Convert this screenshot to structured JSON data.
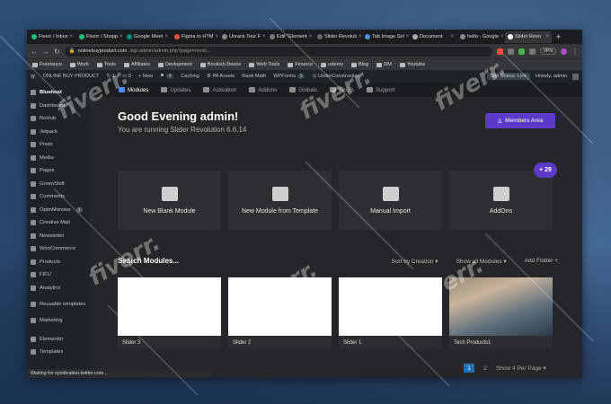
{
  "tabs": [
    {
      "label": "Fiverr / Inbox",
      "color": "#1dbf73"
    },
    {
      "label": "Fiverr / Shopp",
      "color": "#1dbf73"
    },
    {
      "label": "Google Meet",
      "color": "#00897b"
    },
    {
      "label": "Figma to HTM",
      "color": "#e94f3d"
    },
    {
      "label": "Unrack Tour F",
      "color": "#888888"
    },
    {
      "label": "Edit \"Element",
      "color": "#777777"
    },
    {
      "label": "Slider Revoluti",
      "color": "#666666"
    },
    {
      "label": "Tab Image Sel",
      "color": "#4a90d9"
    },
    {
      "label": "Document",
      "color": "#aaaaaa"
    },
    {
      "label": "hello - Google",
      "color": "#888888"
    },
    {
      "label": "Slider Revo",
      "color": "#ffffff"
    }
  ],
  "address": {
    "url": "onlinebuyproduct.com",
    "path": "/wp-admin/admin.php?page=revsli...",
    "vpn": "VPN"
  },
  "bookmarks": [
    "Freelance",
    "Work",
    "Tools",
    "Affiliates",
    "Devlopment",
    "Bookish Desire",
    "Web Tools",
    "Finance",
    "udemy",
    "Blog",
    "DM",
    "Youtube"
  ],
  "wpbar": {
    "site": "ONLINE BUY PRODUCT",
    "updates": "1",
    "comments": "0",
    "new": "+ New",
    "sg": "4",
    "caching": "Caching",
    "pa": "PA Assets",
    "seo": "Rank Math",
    "wpforms": "WPForms",
    "wpforms_count": "3",
    "uc": "UnderConstruction",
    "status": "Site Status: Live",
    "howdy": "Howdy, admin"
  },
  "sidebar": [
    {
      "label": "Bluehost",
      "current": false,
      "bold": true
    },
    {
      "label": "Dashboard"
    },
    {
      "label": "ReHub"
    },
    {
      "label": "Jetpack"
    },
    {
      "label": "Posts"
    },
    {
      "label": "Media"
    },
    {
      "label": "Pages"
    },
    {
      "label": "GreenShift"
    },
    {
      "label": "Comments"
    },
    {
      "label": "OptinMonster",
      "badge": "1"
    },
    {
      "label": "Creative Mail"
    },
    {
      "label": "Newsletter"
    },
    {
      "label": "WooCommerce"
    },
    {
      "label": "Products"
    },
    {
      "label": "FIFU"
    },
    {
      "label": "Analytics"
    },
    {
      "label": "Reusable templates"
    },
    {
      "label": "Marketing"
    },
    {
      "label": "Elementor"
    },
    {
      "label": "Templates"
    }
  ],
  "subnav": [
    "Modules",
    "Updates",
    "Activation",
    "Addons",
    "Globals",
    "FAQ's",
    "Support"
  ],
  "greeting": "Good Evening admin!",
  "running": "You are running Slider Revolution 6.6.14",
  "members": "Members Area",
  "plus": "+ 29",
  "cards": [
    "New Blank Module",
    "New Module from Template",
    "Manual Import",
    "AddOns"
  ],
  "search": {
    "title": "Search Modules...",
    "sort": "Sort by Creation",
    "show": "Show all Modules",
    "folder": "Add Folder"
  },
  "slides": [
    {
      "name": "Slider 3",
      "photo": false
    },
    {
      "name": "Slider 2",
      "photo": false
    },
    {
      "name": "Slider 1",
      "photo": false
    },
    {
      "name": "Tech Products1",
      "photo": true
    }
  ],
  "pager": {
    "p1": "1",
    "p2": "2",
    "show": "Show 4 Per Page"
  },
  "statusbar": "Waiting for syndication.twitter.com...",
  "watermark": "fiverr."
}
